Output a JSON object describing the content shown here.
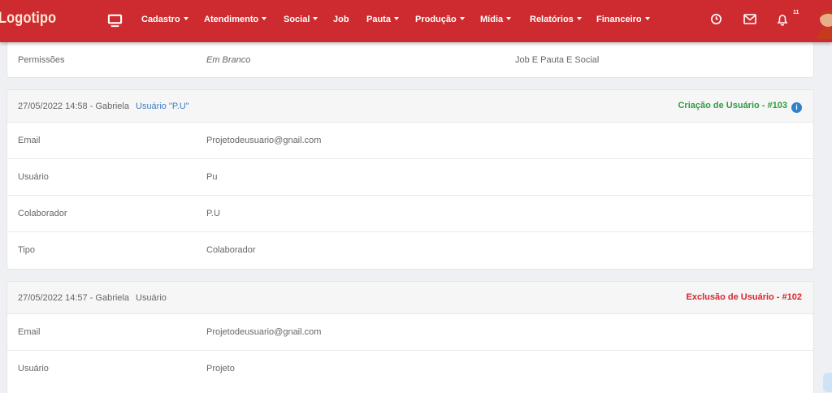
{
  "nav": {
    "logo": "Logotipo",
    "items": [
      {
        "label": "Cadastro",
        "dropdown": true
      },
      {
        "label": "Atendimento",
        "dropdown": true
      },
      {
        "label": "Social",
        "dropdown": true
      },
      {
        "label": "Job",
        "dropdown": false
      },
      {
        "label": "Pauta",
        "dropdown": true
      },
      {
        "label": "Produção",
        "dropdown": true
      },
      {
        "label": "Mídia",
        "dropdown": true
      },
      {
        "label": "Relatórios",
        "dropdown": true
      },
      {
        "label": "Financeiro",
        "dropdown": true
      }
    ],
    "notification_count": "11"
  },
  "colors": {
    "brand": "#cd2b2f",
    "create": "#2e9e3f",
    "delete": "#d9262c",
    "link": "#3f7fbf"
  },
  "icons": [
    "desktop-icon",
    "clock-icon",
    "mail-icon",
    "bell-icon",
    "avatar",
    "info-icon",
    "chat-icon"
  ],
  "permissions_card": {
    "label": "Permissões",
    "value": "Em Branco",
    "extra": "Job E Pauta E Social"
  },
  "logs": [
    {
      "date": "27/05/2022 14:58 - Gabriela",
      "target": "Usuário \"P.U\"",
      "action": "Criação de Usuário - #103",
      "rows": [
        {
          "label": "Email",
          "value": "Projetodeusuario@gnail.com"
        },
        {
          "label": "Usuário",
          "value": "Pu"
        },
        {
          "label": "Colaborador",
          "value": "P.U"
        },
        {
          "label": "Tipo",
          "value": "Colaborador"
        }
      ]
    },
    {
      "date": "27/05/2022 14:57 - Gabriela",
      "target": "Usuário",
      "action": "Exclusão de Usuário - #102",
      "rows": [
        {
          "label": "Email",
          "value": "Projetodeusuario@gnail.com"
        },
        {
          "label": "Usuário",
          "value": "Projeto"
        }
      ]
    }
  ]
}
